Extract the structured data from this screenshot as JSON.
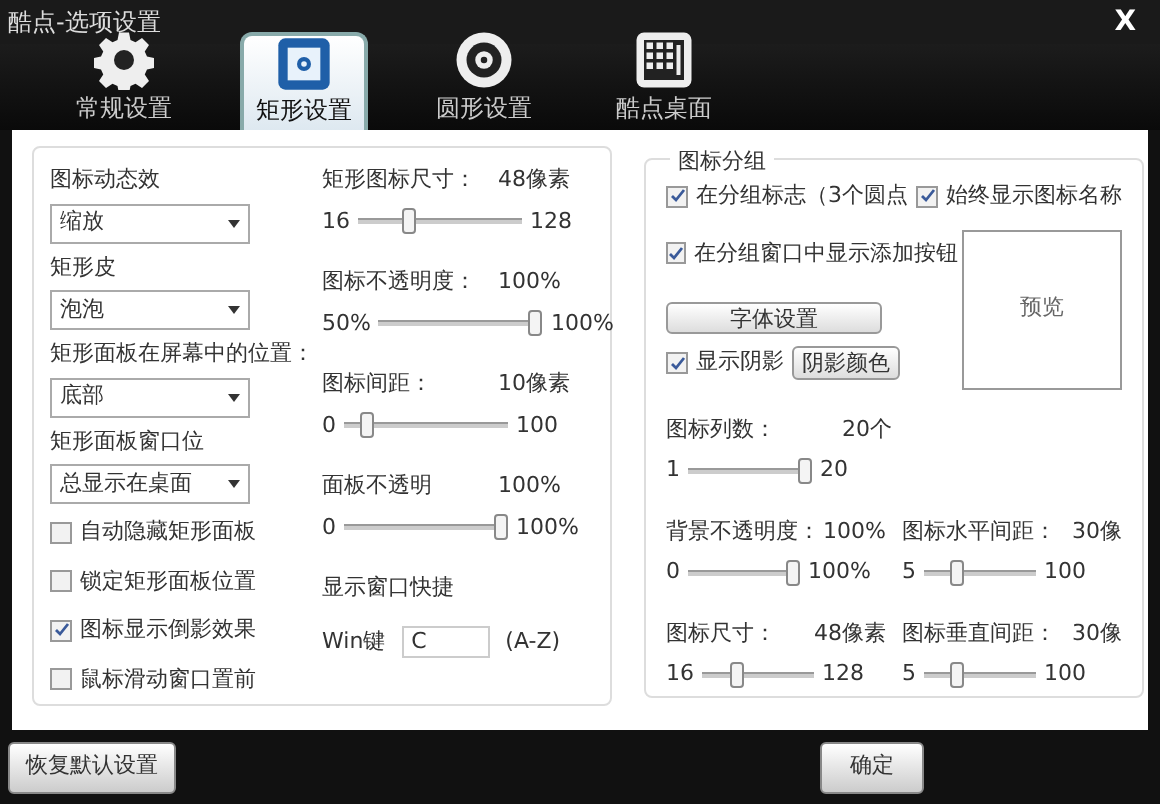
{
  "window": {
    "title": "酷点-选项设置",
    "close": "X"
  },
  "tabs": [
    {
      "label": "常规设置",
      "selected": false
    },
    {
      "label": "矩形设置",
      "selected": true
    },
    {
      "label": "圆形设置",
      "selected": false
    },
    {
      "label": "酷点桌面",
      "selected": false
    }
  ],
  "left": {
    "dropdowns": [
      {
        "label": "图标动态效",
        "value": "缩放"
      },
      {
        "label": "矩形皮",
        "value": "泡泡"
      },
      {
        "label": "矩形面板在屏幕中的位置：",
        "value": "底部"
      },
      {
        "label": "矩形面板窗口位",
        "value": "总显示在桌面"
      }
    ],
    "checkboxes": [
      {
        "label": "自动隐藏矩形面板",
        "checked": false
      },
      {
        "label": "锁定矩形面板位置",
        "checked": false
      },
      {
        "label": "图标显示倒影效果",
        "checked": true
      },
      {
        "label": "鼠标滑动窗口置前",
        "checked": false
      }
    ],
    "sliders": [
      {
        "label": "矩形图标尺寸：",
        "reading": "48像素",
        "min": "16",
        "max": "128",
        "level": 0.29
      },
      {
        "label": "图标不透明度：",
        "reading": "100%",
        "min": "50%",
        "max": "100%",
        "level": 1
      },
      {
        "label": "图标间距：",
        "reading": "10像素",
        "min": "0",
        "max": "100",
        "level": 0.1
      },
      {
        "label": "面板不透明",
        "reading": "100%",
        "min": "0",
        "max": "100%",
        "level": 1
      }
    ],
    "hotkey": {
      "title": "显示窗口快捷",
      "label": "Win键",
      "value": "C",
      "hint": "(A-Z)"
    }
  },
  "group": {
    "title": "图标分组",
    "checkboxes": [
      {
        "label": "在分组标志（3个圆点",
        "checked": true
      },
      {
        "label": "始终显示图标名称",
        "checked": true
      },
      {
        "label": "在分组窗口中显示添加按钮",
        "checked": true
      }
    ],
    "font_button": "字体设置",
    "shadow": {
      "label": "显示阴影",
      "checked": true,
      "button": "阴影颜色"
    },
    "preview": "预览",
    "sliders": [
      {
        "label": "图标列数：",
        "reading": "20个",
        "min": "1",
        "max": "20",
        "level": 1
      },
      {
        "label": "背景不透明度：",
        "reading": "100%",
        "min": "0",
        "max": "100%",
        "level": 1
      },
      {
        "label": "图标水平间距：",
        "reading": "30像",
        "min": "5",
        "max": "100",
        "level": 0.26
      },
      {
        "label": "图标尺寸：",
        "reading": "48像素",
        "min": "16",
        "max": "128",
        "level": 0.29
      },
      {
        "label": "图标垂直间距：",
        "reading": "30像",
        "min": "5",
        "max": "100",
        "level": 0.26
      }
    ]
  },
  "buttons": {
    "reset": "恢复默认设置",
    "ok": "确定"
  }
}
